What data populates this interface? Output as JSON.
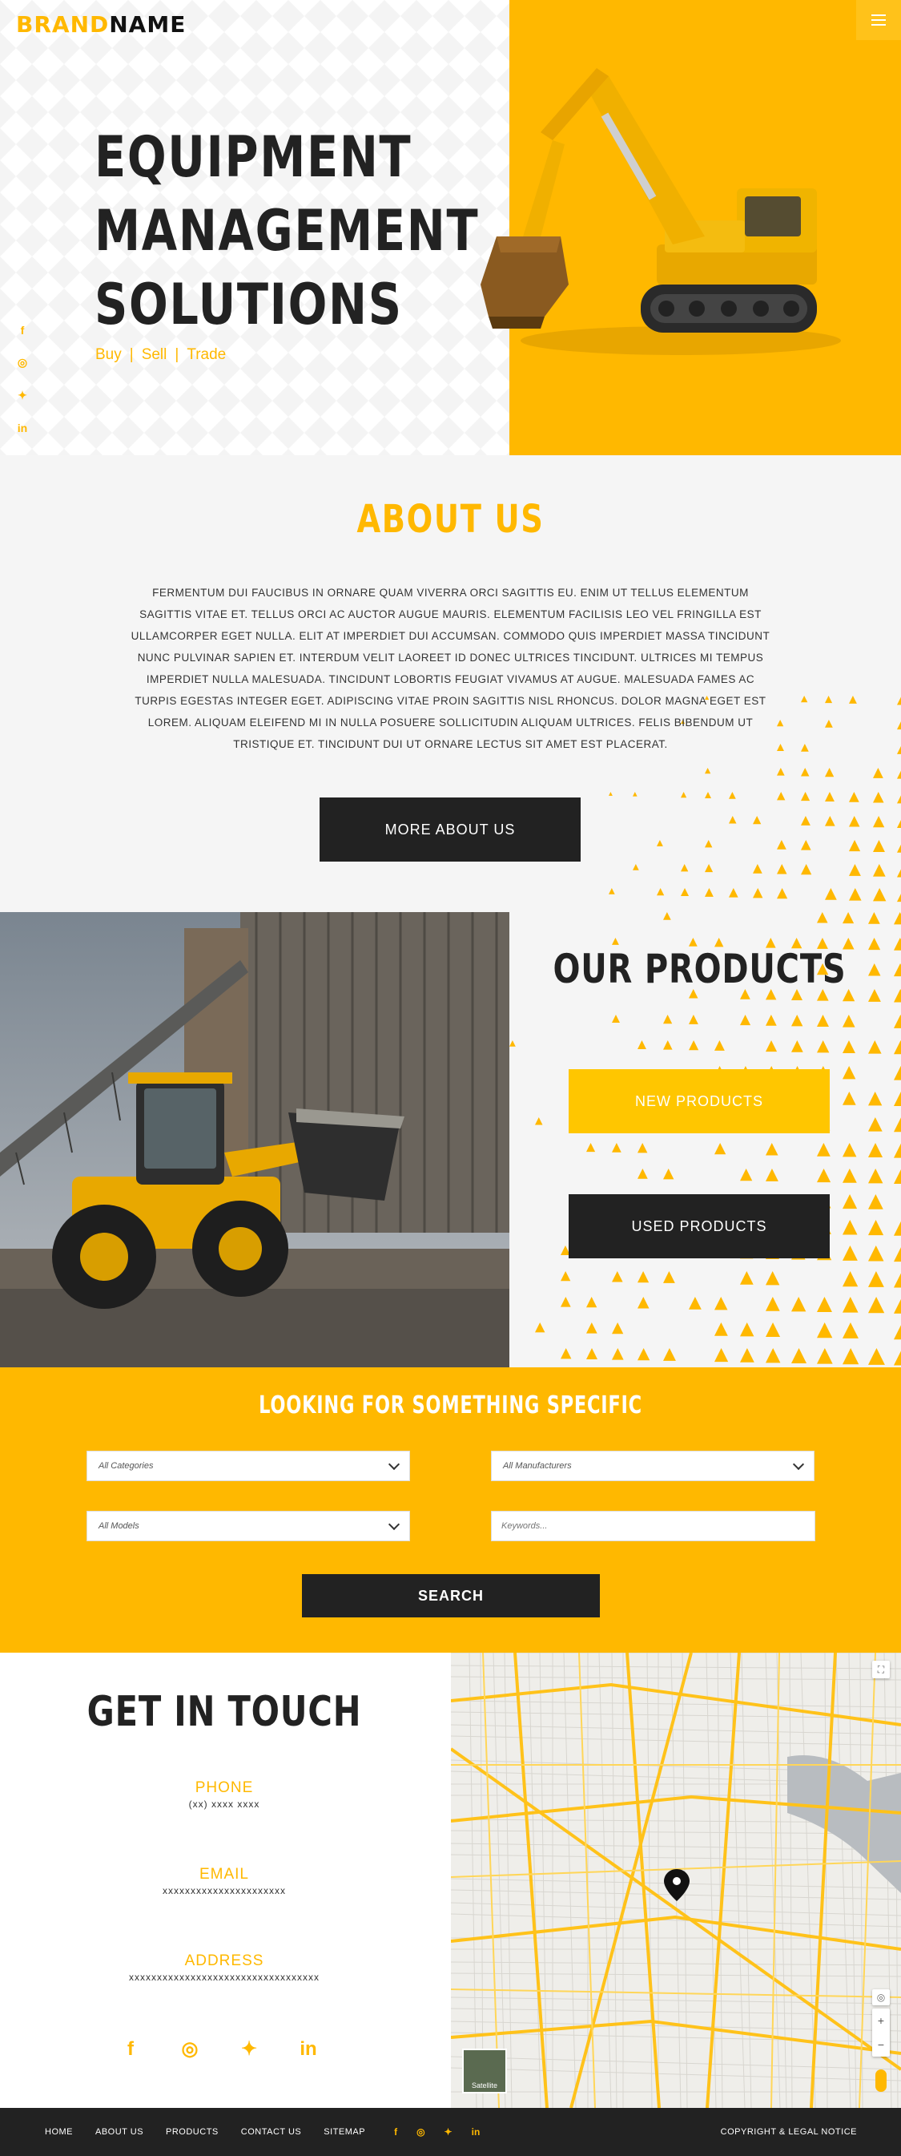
{
  "header": {
    "brand_part1": "BRAND",
    "brand_part2": "NAME"
  },
  "hero": {
    "title_lines": [
      "EQUIPMENT",
      "MANAGEMENT",
      "SOLUTIONS"
    ],
    "tags": [
      "Buy",
      "Sell",
      "Trade"
    ],
    "social_icons": [
      "facebook-icon",
      "instagram-icon",
      "twitter-icon",
      "linkedin-icon"
    ]
  },
  "about": {
    "heading": "ABOUT US",
    "body": "FERMENTUM DUI FAUCIBUS IN ORNARE QUAM VIVERRA ORCI SAGITTIS EU. ENIM UT TELLUS ELEMENTUM SAGITTIS VITAE ET. TELLUS ORCI AC AUCTOR AUGUE MAURIS. ELEMENTUM FACILISIS LEO VEL FRINGILLA EST ULLAMCORPER EGET NULLA. ELIT AT IMPERDIET DUI ACCUMSAN. COMMODO QUIS IMPERDIET MASSA TINCIDUNT NUNC PULVINAR SAPIEN ET. INTERDUM VELIT LAOREET ID DONEC ULTRICES TINCIDUNT. ULTRICES MI TEMPUS IMPERDIET NULLA MALESUADA. TINCIDUNT LOBORTIS FEUGIAT VIVAMUS AT AUGUE. MALESUADA FAMES AC TURPIS EGESTAS INTEGER EGET. ADIPISCING VITAE PROIN SAGITTIS NISL RHONCUS. DOLOR MAGNA EGET EST LOREM. ALIQUAM ELEIFEND MI IN NULLA POSUERE SOLLICITUDIN ALIQUAM ULTRICES. FELIS BIBENDUM UT TRISTIQUE ET. TINCIDUNT DUI UT ORNARE LECTUS SIT AMET EST PLACERAT.",
    "button": "MORE ABOUT US"
  },
  "products": {
    "heading": "OUR PRODUCTS",
    "new_button": "NEW PRODUCTS",
    "used_button": "USED PRODUCTS"
  },
  "search": {
    "heading": "LOOKING FOR SOMETHING SPECIFIC",
    "categories": "All Categories",
    "manufacturers": "All Manufacturers",
    "models": "All Models",
    "keywords_placeholder": "Keywords...",
    "button": "SEARCH"
  },
  "contact": {
    "heading": "GET IN TOUCH",
    "phone_label": "PHONE",
    "phone_value": "(xx) xxxx xxxx",
    "email_label": "EMAIL",
    "email_value": "xxxxxxxxxxxxxxxxxxxxxx",
    "address_label": "ADDRESS",
    "address_value": "xxxxxxxxxxxxxxxxxxxxxxxxxxxxxxxxxx",
    "map_label": "Satellite"
  },
  "footer": {
    "nav": [
      "HOME",
      "ABOUT US",
      "PRODUCTS",
      "CONTACT US",
      "SITEMAP"
    ],
    "copyright": "COPYRIGHT & LEGAL NOTICE"
  },
  "colors": {
    "accent": "#ffb800",
    "dark": "#222222",
    "light_bg": "#f5f5f5"
  }
}
